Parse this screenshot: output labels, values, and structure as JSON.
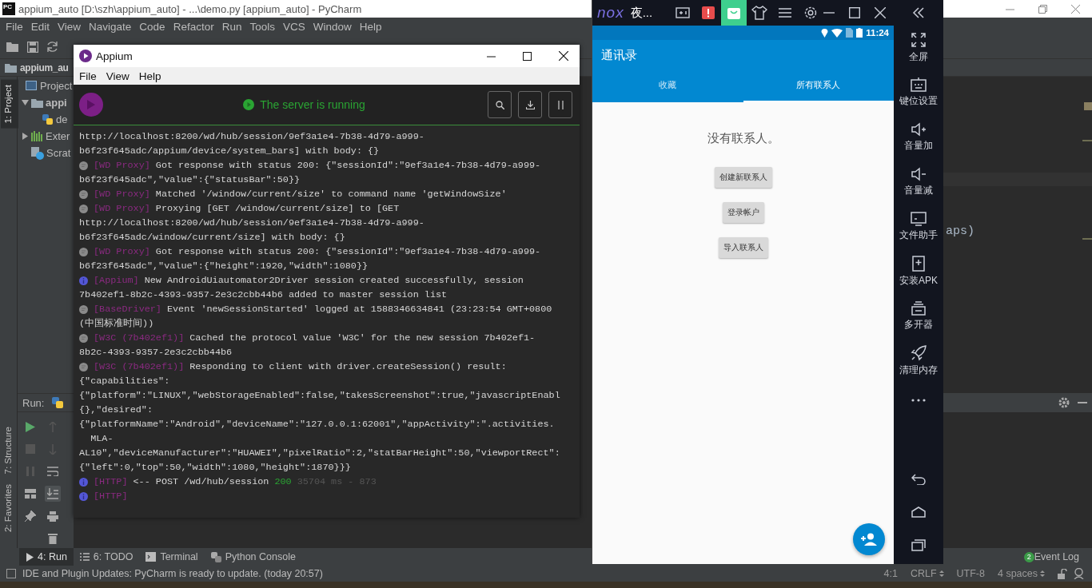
{
  "pycharm": {
    "app_icon": "PC",
    "title": "appium_auto [D:\\szh\\appium_auto] - ...\\demo.py [appium_auto] - PyCharm",
    "menu": [
      "File",
      "Edit",
      "View",
      "Navigate",
      "Code",
      "Refactor",
      "Run",
      "Tools",
      "VCS",
      "Window",
      "Help"
    ],
    "navigation": "appium_au",
    "project_header": "Project",
    "tree": [
      {
        "label": "appi",
        "kind": "folder",
        "expanded": true,
        "children": [
          {
            "label": "de",
            "kind": "python"
          }
        ]
      },
      {
        "label": "Exter",
        "kind": "library",
        "expanded": false
      },
      {
        "label": "Scrat",
        "kind": "scratch"
      }
    ],
    "tool_windows": [
      {
        "label": "1: Project",
        "selected": true
      },
      {
        "label": "7: Structure",
        "selected": false
      },
      {
        "label": "2: Favorites",
        "selected": false
      }
    ],
    "run_label": "Run:",
    "run_toolbar": {
      "scroll_to_end": true
    },
    "editor_fragment": "aps)",
    "bottom_tabs": [
      {
        "label": "4: Run",
        "kind": "run",
        "selected": true
      },
      {
        "label": "6: TODO",
        "kind": "todo",
        "selected": false
      },
      {
        "label": "Terminal",
        "kind": "terminal",
        "selected": false
      },
      {
        "label": "Python Console",
        "kind": "python",
        "selected": false
      }
    ],
    "event_log": {
      "count": "2",
      "label": "Event Log"
    },
    "status_message": "IDE and Plugin Updates: PyCharm is ready to update. (today 20:57)",
    "status_items": [
      {
        "label": "4:1",
        "dropdown": false
      },
      {
        "label": "CRLF",
        "dropdown": true
      },
      {
        "label": "UTF-8",
        "dropdown": false
      },
      {
        "label": "4 spaces",
        "dropdown": true
      }
    ]
  },
  "appium": {
    "title": "Appium",
    "menu": [
      "File",
      "View",
      "Help"
    ],
    "status": "The server is running",
    "logs": [
      {
        "text": "http://localhost:8200/wd/hub/session/9ef3a1e4-7b38-4d79-a999-",
        "more": [
          "b6f23f645adc/appium/device/system_bars] with body: {}"
        ]
      },
      {
        "kind": "debug",
        "tag": "[WD Proxy]",
        "text": "Got response with status 200: {\"sessionId\":\"9ef3a1e4-7b38-4d79-a999-",
        "more": [
          "b6f23f645adc\",\"value\":{\"statusBar\":50}}"
        ]
      },
      {
        "kind": "debug",
        "tag": "[WD Proxy]",
        "text": "Matched '/window/current/size' to command name 'getWindowSize'"
      },
      {
        "kind": "debug",
        "tag": "[WD Proxy]",
        "text": "Proxying [GET /window/current/size] to [GET",
        "more": [
          "http://localhost:8200/wd/hub/session/9ef3a1e4-7b38-4d79-a999-",
          "b6f23f645adc/window/current/size] with body: {}"
        ]
      },
      {
        "kind": "debug",
        "tag": "[WD Proxy]",
        "text": "Got response with status 200: {\"sessionId\":\"9ef3a1e4-7b38-4d79-a999-",
        "more": [
          "b6f23f645adc\",\"value\":{\"height\":1920,\"width\":1080}}"
        ]
      },
      {
        "kind": "info",
        "tag": "[Appium]",
        "text": "New AndroidUiautomator2Driver session created successfully, session",
        "more": [
          "7b402ef1-8b2c-4393-9357-2e3c2cbb44b6 added to master session list"
        ]
      },
      {
        "kind": "debug",
        "tag": "[BaseDriver]",
        "text": "Event 'newSessionStarted' logged at 1588346634841 (23:23:54 GMT+0800",
        "more": [
          "(中国标准时间))"
        ]
      },
      {
        "kind": "debug",
        "tag": "[W3C (7b402ef1)]",
        "text": "Cached the protocol value 'W3C' for the new session 7b402ef1-",
        "more": [
          "8b2c-4393-9357-2e3c2cbb44b6"
        ]
      },
      {
        "kind": "debug",
        "tag": "[W3C (7b402ef1)]",
        "text": "Responding to client with driver.createSession() result:",
        "more": [
          "{\"capabilities\":",
          "{\"platform\":\"LINUX\",\"webStorageEnabled\":false,\"takesScreenshot\":true,\"javascriptEnabl",
          "{},\"desired\":",
          "{\"platformName\":\"Android\",\"deviceName\":\"127.0.0.1:62001\",\"appActivity\":\".activities.",
          "  MLA-",
          "AL10\",\"deviceManufacturer\":\"HUAWEI\",\"pixelRatio\":2,\"statBarHeight\":50,\"viewportRect\":",
          "{\"left\":0,\"top\":50,\"width\":1080,\"height\":1870}}}"
        ]
      },
      {
        "kind": "info",
        "tag": "[HTTP]",
        "text": "<-- POST /wd/hub/session",
        "status_code": "200",
        "timing": "35704 ms - 873"
      },
      {
        "kind": "info",
        "tag": "[HTTP]"
      }
    ]
  },
  "nox": {
    "brand": "nox",
    "title": "夜...",
    "toolbar": [
      {
        "kind": "keyboard",
        "selected": false
      },
      {
        "kind": "alert",
        "selected": false
      },
      {
        "kind": "bag",
        "selected": true
      },
      {
        "kind": "shirt",
        "selected": false
      },
      {
        "kind": "menu",
        "selected": false
      },
      {
        "kind": "gear",
        "selected": false
      }
    ],
    "sidebar": [
      {
        "kind": "fullscreen",
        "label": "全屏"
      },
      {
        "kind": "keymap",
        "label": "键位设置"
      },
      {
        "kind": "volume_up",
        "label": "音量加"
      },
      {
        "kind": "volume_down",
        "label": "音量减"
      },
      {
        "kind": "files",
        "label": "文件助手"
      },
      {
        "kind": "apk",
        "label": "安装APK"
      },
      {
        "kind": "multi",
        "label": "多开器"
      },
      {
        "kind": "clean",
        "label": "清理内存"
      }
    ],
    "phone": {
      "time": "11:24",
      "app_title": "通讯录",
      "tabs": [
        {
          "label": "收藏",
          "selected": false
        },
        {
          "label": "所有联系人",
          "selected": true
        }
      ],
      "empty_text": "没有联系人。",
      "buttons": [
        "创建新联系人",
        "登录帐户",
        "导入联系人"
      ]
    }
  }
}
